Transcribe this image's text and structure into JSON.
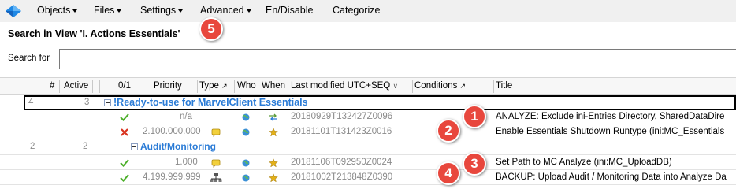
{
  "menubar": {
    "items": [
      {
        "label": "Objects",
        "dropdown": true
      },
      {
        "label": "Files",
        "dropdown": true
      },
      {
        "label": "Settings",
        "dropdown": true
      },
      {
        "label": "Advanced",
        "dropdown": true
      },
      {
        "label": "En/Disable",
        "dropdown": false
      },
      {
        "label": "Categorize",
        "dropdown": false
      }
    ]
  },
  "view": {
    "title": "Search in View 'I. Actions Essentials'",
    "search_label": "Search for",
    "search_value": ""
  },
  "columns": {
    "num": "#",
    "active": "Active",
    "zero_one": "0/1",
    "priority": "Priority",
    "type": "Type",
    "who": "Who",
    "when": "When",
    "last_modified": "Last modified UTC+SEQ",
    "conditions": "Conditions",
    "title": "Title"
  },
  "groups": [
    {
      "num": "4",
      "active": "3",
      "label": "!Ready-to-use for MarvelClient Essentials"
    },
    {
      "num": "2",
      "active": "2",
      "label": "Audit/Monitoring"
    }
  ],
  "rows": [
    {
      "status": "check",
      "priority": "n/a",
      "type": "",
      "who": "globe",
      "when": "arrows",
      "modified": "20180929T132427Z0096",
      "title": "ANALYZE: Exclude ini-Entries Directory, SharedDataDire"
    },
    {
      "status": "cross",
      "priority": "2.100.000.000",
      "type": "note",
      "who": "globe",
      "when": "star",
      "modified": "20181101T131423Z0016",
      "title": "Enable Essentials Shutdown Runtype (ini:MC_Essentials"
    },
    {
      "status": "check",
      "priority": "1.000",
      "type": "note",
      "who": "globe",
      "when": "star",
      "modified": "20181106T092950Z0024",
      "title": "Set Path to MC Analyze (ini:MC_UploadDB)"
    },
    {
      "status": "check",
      "priority": "4.199.999.999",
      "type": "network",
      "who": "globe",
      "when": "star",
      "modified": "20181002T213848Z0390",
      "title": "BACKUP: Upload Audit / Monitoring Data into Analyze Da"
    }
  ],
  "badges": [
    "5",
    "1",
    "2",
    "3",
    "4"
  ],
  "colors": {
    "accent_blue": "#2a7bd6",
    "badge_red": "#e8473d",
    "check_green": "#4caf2a",
    "cross_red": "#d9331f",
    "star_yellow": "#e3b018"
  }
}
